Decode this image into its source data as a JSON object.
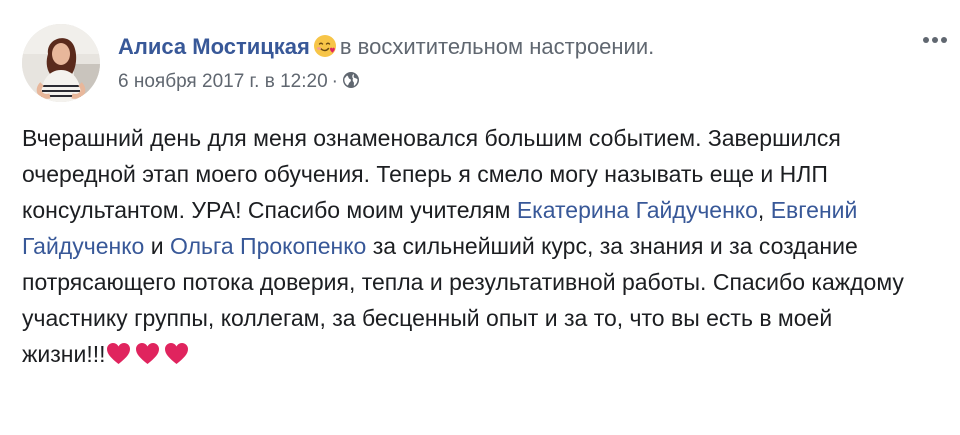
{
  "post": {
    "author": "Алиса Мостицкая",
    "feeling_text": "в восхитительном настроении.",
    "feeling_emoji": "smiling-face-with-hearts-icon",
    "timestamp": "6 ноября 2017 г. в 12:20",
    "separator": "·",
    "privacy_icon": "globe-icon",
    "more_icon": "more-options-icon",
    "body": {
      "text_1": "Вчерашний день для меня ознаменовался большим событием. Завершился очередной этап моего обучения. Теперь я смело могу называть еще и НЛП консультантом. УРА! Спасибо моим учителям ",
      "mention_1": "Екатерина Гайдученко",
      "text_2": ", ",
      "mention_2": "Евгений Гайдученко",
      "text_3": " и ",
      "mention_3": "Ольга Прокопенко",
      "text_4": " за сильнейший курс, за знания и за создание потрясающего потока доверия, тепла и результативной работы. Спасибо каждому участнику группы, коллегам, за бесценный опыт и за то, что вы есть в моей жизни!!!",
      "hearts_icon": "red-heart-icon"
    }
  },
  "colors": {
    "link": "#385898",
    "secondary_text": "#606770",
    "body_text": "#1c1e21",
    "heart": "#e0245e"
  }
}
